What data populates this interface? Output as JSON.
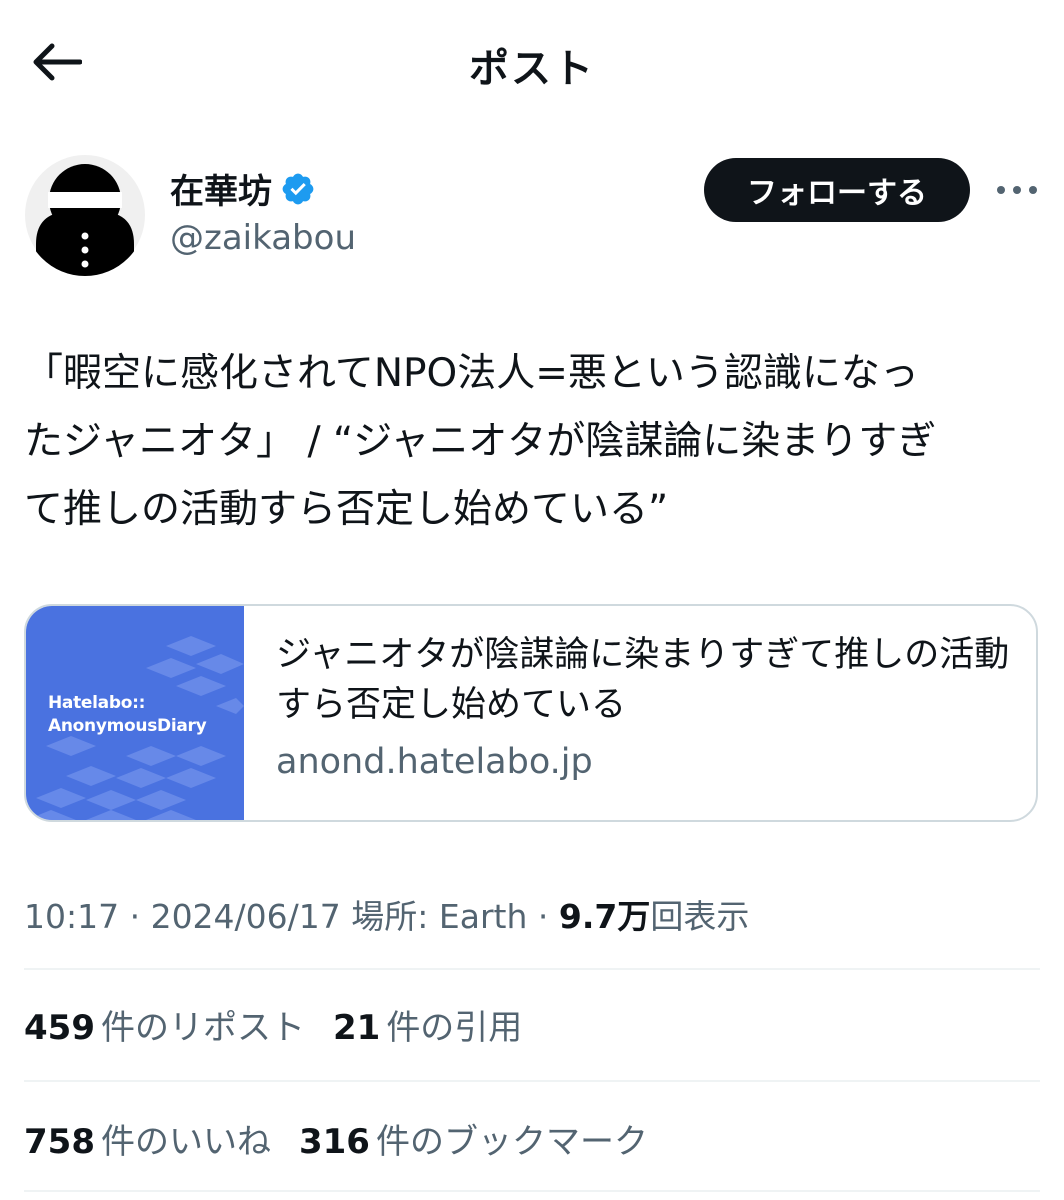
{
  "header": {
    "title": "ポスト"
  },
  "author": {
    "display_name": "在華坊",
    "handle": "@zaikabou",
    "verified": true
  },
  "actions": {
    "follow_label": "フォローする"
  },
  "tweet": {
    "lines": [
      "「暇空に感化されてNPO法人=悪という認識になっ",
      "たジャニオタ」 / “ジャニオタが陰謀論に染まりすぎ",
      "て推しの活動すら否定し始めている”"
    ]
  },
  "card": {
    "thumb_label_line1": "Hatelabo::",
    "thumb_label_line2": "AnonymousDiary",
    "title": "ジャニオタが陰謀論に染まりすぎて推しの活動すら否定し始めている",
    "domain": "anond.hatelabo.jp"
  },
  "meta": {
    "time_date": "10:17 · 2024/06/17",
    "location": "場所: Earth",
    "separator": "·",
    "views_count": "9.7万",
    "views_label": "回表示"
  },
  "stats": {
    "reposts_count": "459",
    "reposts_label": "件のリポスト",
    "quotes_count": "21",
    "quotes_label": "件の引用",
    "likes_count": "758",
    "likes_label": "件のいいね",
    "bookmarks_count": "316",
    "bookmarks_label": "件のブックマーク"
  },
  "colors": {
    "text": "#0f1419",
    "secondary": "#536471",
    "verified_blue": "#1d9bf0",
    "card_thumb": "#4a72e0",
    "divider": "#eff3f4"
  }
}
